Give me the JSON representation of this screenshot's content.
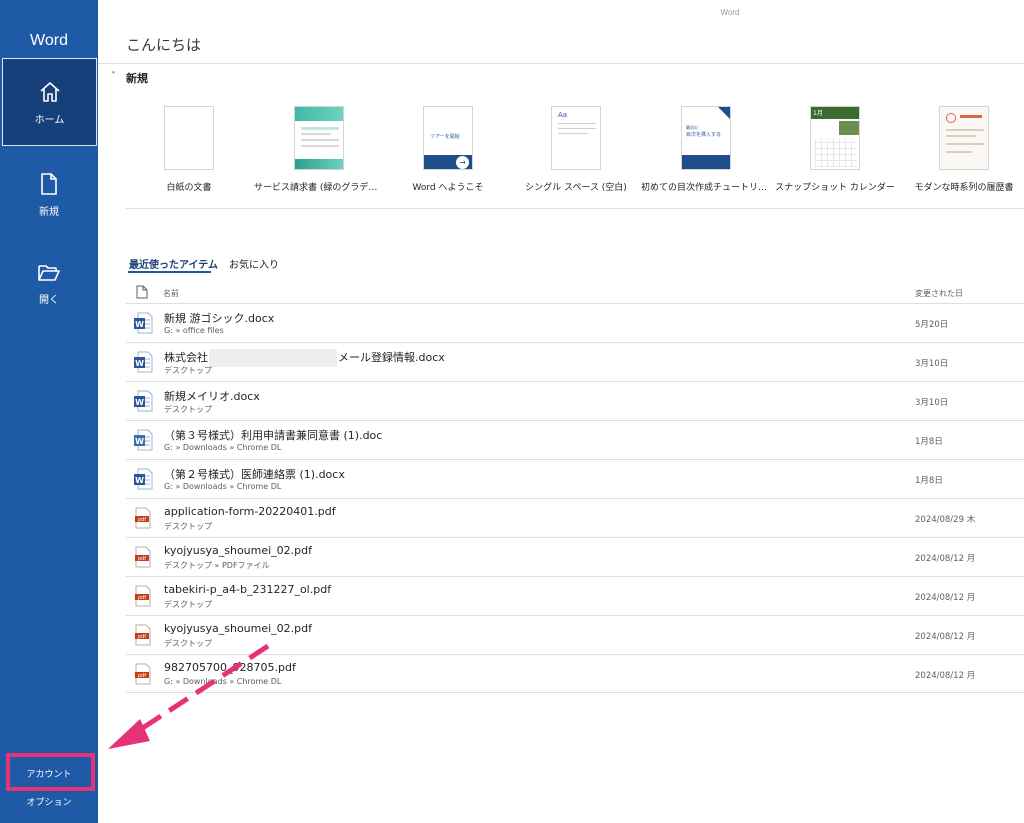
{
  "window": {
    "title": "Word"
  },
  "sidebar": {
    "brand": "Word",
    "items": [
      {
        "label": "ホーム",
        "icon": "home-icon",
        "active": true
      },
      {
        "label": "新規",
        "icon": "new-document-icon",
        "active": false
      },
      {
        "label": "開く",
        "icon": "folder-open-icon",
        "active": false
      }
    ],
    "bottom": {
      "account": "アカウント",
      "options": "オプション"
    }
  },
  "main": {
    "greeting": "こんにちは",
    "new_section": {
      "title": "新規",
      "toggle_icon": "chevron-down-icon"
    },
    "templates": [
      {
        "label": "白紙の文書"
      },
      {
        "label": "サービス請求書 (緑のグラデー…"
      },
      {
        "label": "Word へようこそ",
        "thumb_text": "ツアーを開始"
      },
      {
        "label": "シングル スペース (空白)",
        "thumb_text": "Aa"
      },
      {
        "label": "初めての目次作成チュートリアル",
        "thumb_text": "目次を挿入する",
        "thumb_small": "最初の"
      },
      {
        "label": "スナップショット カレンダー",
        "thumb_text": "1月"
      },
      {
        "label": "モダンな時系列の履歴書"
      }
    ],
    "tabs": {
      "recent": "最近使ったアイテム",
      "favorites": "お気に入り"
    },
    "list_header": {
      "name": "名前",
      "modified": "変更された日"
    },
    "files": [
      {
        "name": "新規 游ゴシック.docx",
        "path": "G: » office files",
        "date": "5月20日",
        "type": "word"
      },
      {
        "name_prefix": "株式会社",
        "name_suffix": "メール登録情報.docx",
        "path": "デスクトップ",
        "date": "3月10日",
        "type": "word"
      },
      {
        "name": "新規メイリオ.docx",
        "path": "デスクトップ",
        "date": "3月10日",
        "type": "word"
      },
      {
        "name": "（第３号様式）利用申請書兼同意書 (1).doc",
        "path": "G: » Downloads » Chrome DL",
        "date": "1月8日",
        "type": "word-legacy"
      },
      {
        "name": "（第２号様式）医師連絡票 (1).docx",
        "path": "G: » Downloads » Chrome DL",
        "date": "1月8日",
        "type": "word"
      },
      {
        "name": "application-form-20220401.pdf",
        "path": "デスクトップ",
        "date": "2024/08/29 木",
        "type": "pdf"
      },
      {
        "name": "kyojyusya_shoumei_02.pdf",
        "path": "デスクトップ » PDFファイル",
        "date": "2024/08/12 月",
        "type": "pdf"
      },
      {
        "name": "tabekiri-p_a4-b_231227_ol.pdf",
        "path": "デスクトップ",
        "date": "2024/08/12 月",
        "type": "pdf"
      },
      {
        "name": "kyojyusya_shoumei_02.pdf",
        "path": "デスクトップ",
        "date": "2024/08/12 月",
        "type": "pdf"
      },
      {
        "name": "982705700_928705.pdf",
        "path": "G: » Downloads » Chrome DL",
        "date": "2024/08/12 月",
        "type": "pdf"
      }
    ]
  },
  "colors": {
    "sidebar": "#1f5aa6",
    "active_nav": "#173f79",
    "highlight": "#e5337a",
    "word_blue": "#2b579a",
    "pdf_red": "#c43e1c"
  }
}
